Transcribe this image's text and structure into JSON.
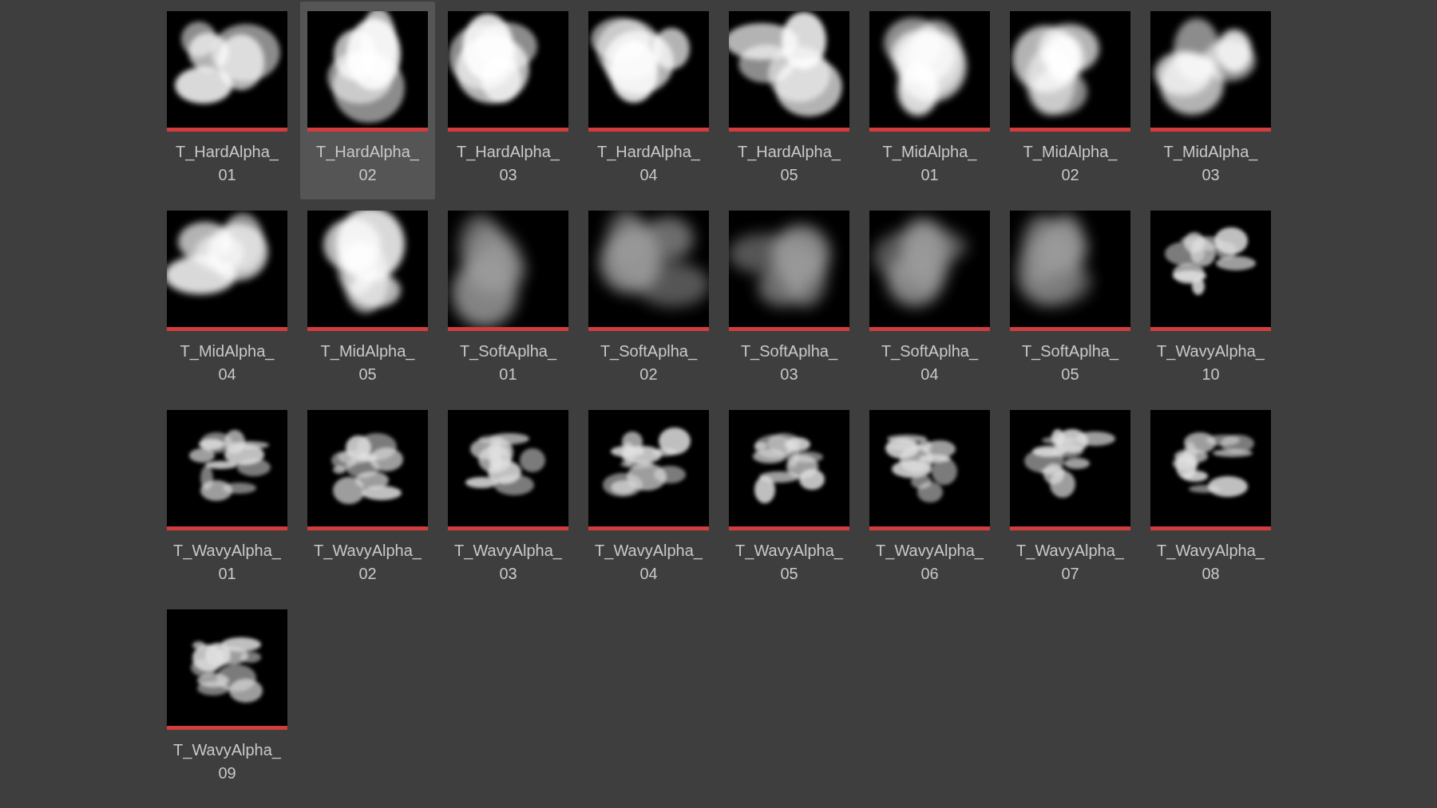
{
  "assets": [
    {
      "name_lines": [
        "T_HardAlpha_",
        "01"
      ],
      "selected": false,
      "kind": "picture"
    },
    {
      "name_lines": [
        "T_HardAlpha_",
        "02"
      ],
      "selected": true,
      "kind": "picture"
    },
    {
      "name_lines": [
        "T_HardAlpha_",
        "03"
      ],
      "selected": false,
      "kind": "picture"
    },
    {
      "name_lines": [
        "T_HardAlpha_",
        "04"
      ],
      "selected": false,
      "kind": "picture"
    },
    {
      "name_lines": [
        "T_HardAlpha_",
        "05"
      ],
      "selected": false,
      "kind": "picture"
    },
    {
      "name_lines": [
        "T_MidAlpha_",
        "01"
      ],
      "selected": false,
      "kind": "picture"
    },
    {
      "name_lines": [
        "T_MidAlpha_",
        "02"
      ],
      "selected": false,
      "kind": "picture"
    },
    {
      "name_lines": [
        "T_MidAlpha_",
        "03"
      ],
      "selected": false,
      "kind": "picture"
    },
    {
      "name_lines": [
        "T_MidAlpha_",
        "04"
      ],
      "selected": false,
      "kind": "picture"
    },
    {
      "name_lines": [
        "T_MidAlpha_",
        "05"
      ],
      "selected": false,
      "kind": "picture"
    },
    {
      "name_lines": [
        "T_SoftAplha_",
        "01"
      ],
      "selected": false,
      "kind": "picture"
    },
    {
      "name_lines": [
        "T_SoftAplha_",
        "02"
      ],
      "selected": false,
      "kind": "picture"
    },
    {
      "name_lines": [
        "T_SoftAplha_",
        "03"
      ],
      "selected": false,
      "kind": "picture"
    },
    {
      "name_lines": [
        "T_SoftAplha_",
        "04"
      ],
      "selected": false,
      "kind": "picture"
    },
    {
      "name_lines": [
        "T_SoftAplha_",
        "05"
      ],
      "selected": false,
      "kind": "picture"
    },
    {
      "name_lines": [
        "T_WavyAlpha_",
        "10"
      ],
      "selected": false,
      "kind": "picture"
    },
    {
      "name_lines": [
        "T_WavyAlpha_",
        "01"
      ],
      "selected": false,
      "kind": "picture"
    },
    {
      "name_lines": [
        "T_WavyAlpha_",
        "02"
      ],
      "selected": false,
      "kind": "picture"
    },
    {
      "name_lines": [
        "T_WavyAlpha_",
        "03"
      ],
      "selected": false,
      "kind": "picture"
    },
    {
      "name_lines": [
        "T_WavyAlpha_",
        "04"
      ],
      "selected": false,
      "kind": "picture"
    },
    {
      "name_lines": [
        "T_WavyAlpha_",
        "05"
      ],
      "selected": false,
      "kind": "picture"
    },
    {
      "name_lines": [
        "T_WavyAlpha_",
        "06"
      ],
      "selected": false,
      "kind": "picture"
    },
    {
      "name_lines": [
        "T_WavyAlpha_",
        "07"
      ],
      "selected": false,
      "kind": "picture"
    },
    {
      "name_lines": [
        "T_WavyAlpha_",
        "08"
      ],
      "selected": false,
      "kind": "picture"
    },
    {
      "name_lines": [
        "T_WavyAlpha_",
        "09"
      ],
      "selected": false,
      "kind": "picture"
    }
  ]
}
